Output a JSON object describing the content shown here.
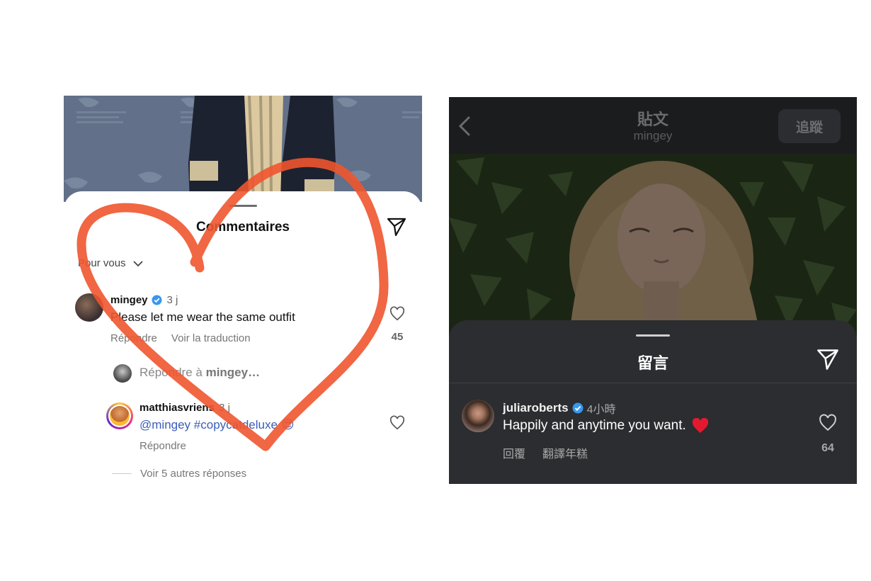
{
  "left_panel": {
    "sheet_title": "Commentaires",
    "filter_label": "Pour vous",
    "comment": {
      "username": "mingey",
      "time": "3 j",
      "text": "Please let me wear the same outfit",
      "reply_label": "Répondre",
      "translate_label": "Voir la traduction",
      "likes": "45"
    },
    "reply_input": {
      "prefix": "Répondre à",
      "target": "mingey…"
    },
    "reply": {
      "username": "matthiasvriens",
      "time": "3 j",
      "text": "@mingey #copycatdeluxe",
      "emoji": "😍",
      "reply_label": "Répondre"
    },
    "more_replies": "Voir 5 autres réponses",
    "scribble_color": "#f0552f"
  },
  "right_panel": {
    "header_title": "貼文",
    "header_subtitle": "mingey",
    "follow_label": "追蹤",
    "sheet_title": "留言",
    "comment": {
      "username": "juliaroberts",
      "time": "4小時",
      "text": "Happily and anytime you want.",
      "emoji": "❤️",
      "reply_label": "回覆",
      "translate_label": "翻譯年糕",
      "likes": "64"
    }
  },
  "colors": {
    "verified_blue": "#3897f0",
    "dark_sheet": "#2b2d30",
    "hashtag_blue": "#3b5db8"
  }
}
